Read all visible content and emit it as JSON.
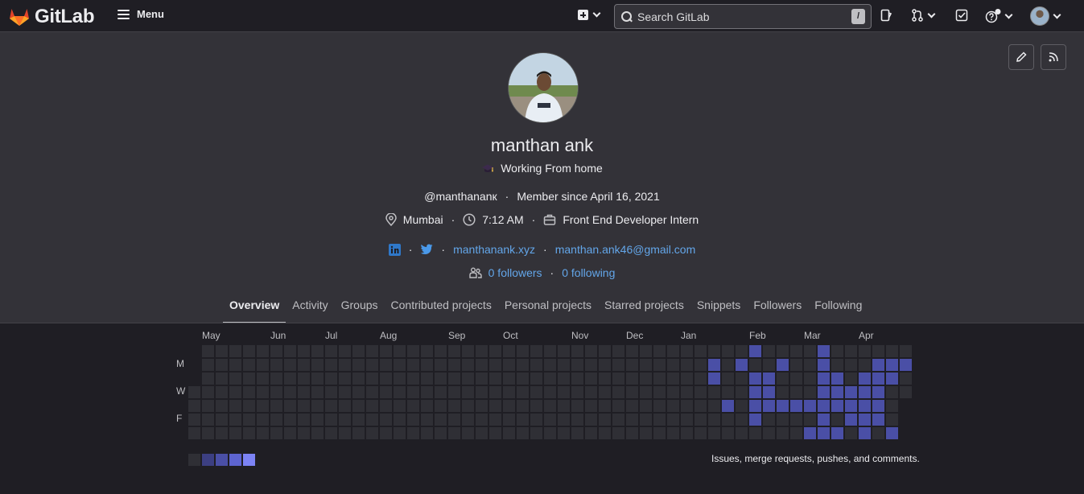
{
  "topbar": {
    "logo_text": "GitLab",
    "menu_label": "Menu",
    "search_placeholder": "Search GitLab",
    "search_shortcut": "/"
  },
  "profile": {
    "name": "manthan ank",
    "status_emoji": "graduation-cap",
    "status_text": "Working From home",
    "username": "@manthananк",
    "member_since": "Member since April 16, 2021",
    "location": "Mumbai",
    "local_time": "7:12 AM",
    "job_title": "Front End Developer Intern",
    "website": "manthanank.xyz",
    "email": "manthan.ank46@gmail.com",
    "followers": "0 followers",
    "following": "0 following"
  },
  "tabs": [
    "Overview",
    "Activity",
    "Groups",
    "Contributed projects",
    "Personal projects",
    "Starred projects",
    "Snippets",
    "Followers",
    "Following"
  ],
  "calendar": {
    "months": [
      "May",
      "Jun",
      "Jul",
      "Aug",
      "Sep",
      "Oct",
      "Nov",
      "Dec",
      "Jan",
      "Feb",
      "Mar",
      "Apr"
    ],
    "day_labels": [
      "M",
      "W",
      "F"
    ],
    "legend_note": "Issues, merge requests, pushes, and comments.",
    "colors": {
      "empty": "#2f2f35",
      "l1": "#3c3f82",
      "l2": "#4a4fa6",
      "l3": "#5d64d0",
      "l4": "#7c83f5"
    }
  },
  "colors": {
    "accent_link": "#63a6e9",
    "bg": "#333238",
    "topbar": "#1f1e24"
  }
}
